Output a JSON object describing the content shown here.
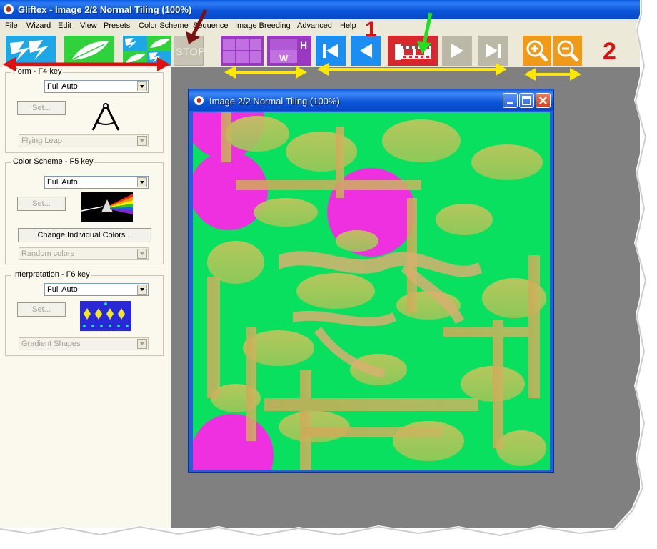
{
  "app": {
    "title": "Gliftex -  Image 2/2 Normal Tiling (100%)"
  },
  "menu": [
    "File",
    "Wizard",
    "Edit",
    "View",
    "Presets",
    "Color Scheme",
    "Sequence",
    "Image Breeding",
    "Advanced",
    "Help"
  ],
  "toolbar": {
    "stop_label": "STOP",
    "grid_buttons": {
      "w_letter": "W",
      "h_letter": "H"
    }
  },
  "annotations": {
    "label_1": "1",
    "label_2": "2"
  },
  "panels": {
    "form": {
      "title": "Form - F4 key",
      "combo": "Full Auto",
      "set": "Set...",
      "sub": "Flying Leap"
    },
    "color": {
      "title": "Color Scheme - F5 key",
      "combo": "Full Auto",
      "set": "Set...",
      "change": "Change Individual Colors...",
      "sub": "Random colors"
    },
    "interp": {
      "title": "Interpretation - F6 key",
      "combo": "Full Auto",
      "set": "Set...",
      "sub": "Gradient Shapes"
    }
  },
  "image_window": {
    "title": "Image 2/2 Normal Tiling (100%)"
  },
  "colors": {
    "titlebar": "#0b55d8",
    "canvas_green": "#0ae060",
    "magenta": "#ee30e0",
    "leaf": "#b6c060",
    "annotation_red": "#e01010",
    "annotation_yellow": "#ffe800",
    "annotation_green": "#20e020",
    "annotation_darkred": "#7a1010"
  }
}
